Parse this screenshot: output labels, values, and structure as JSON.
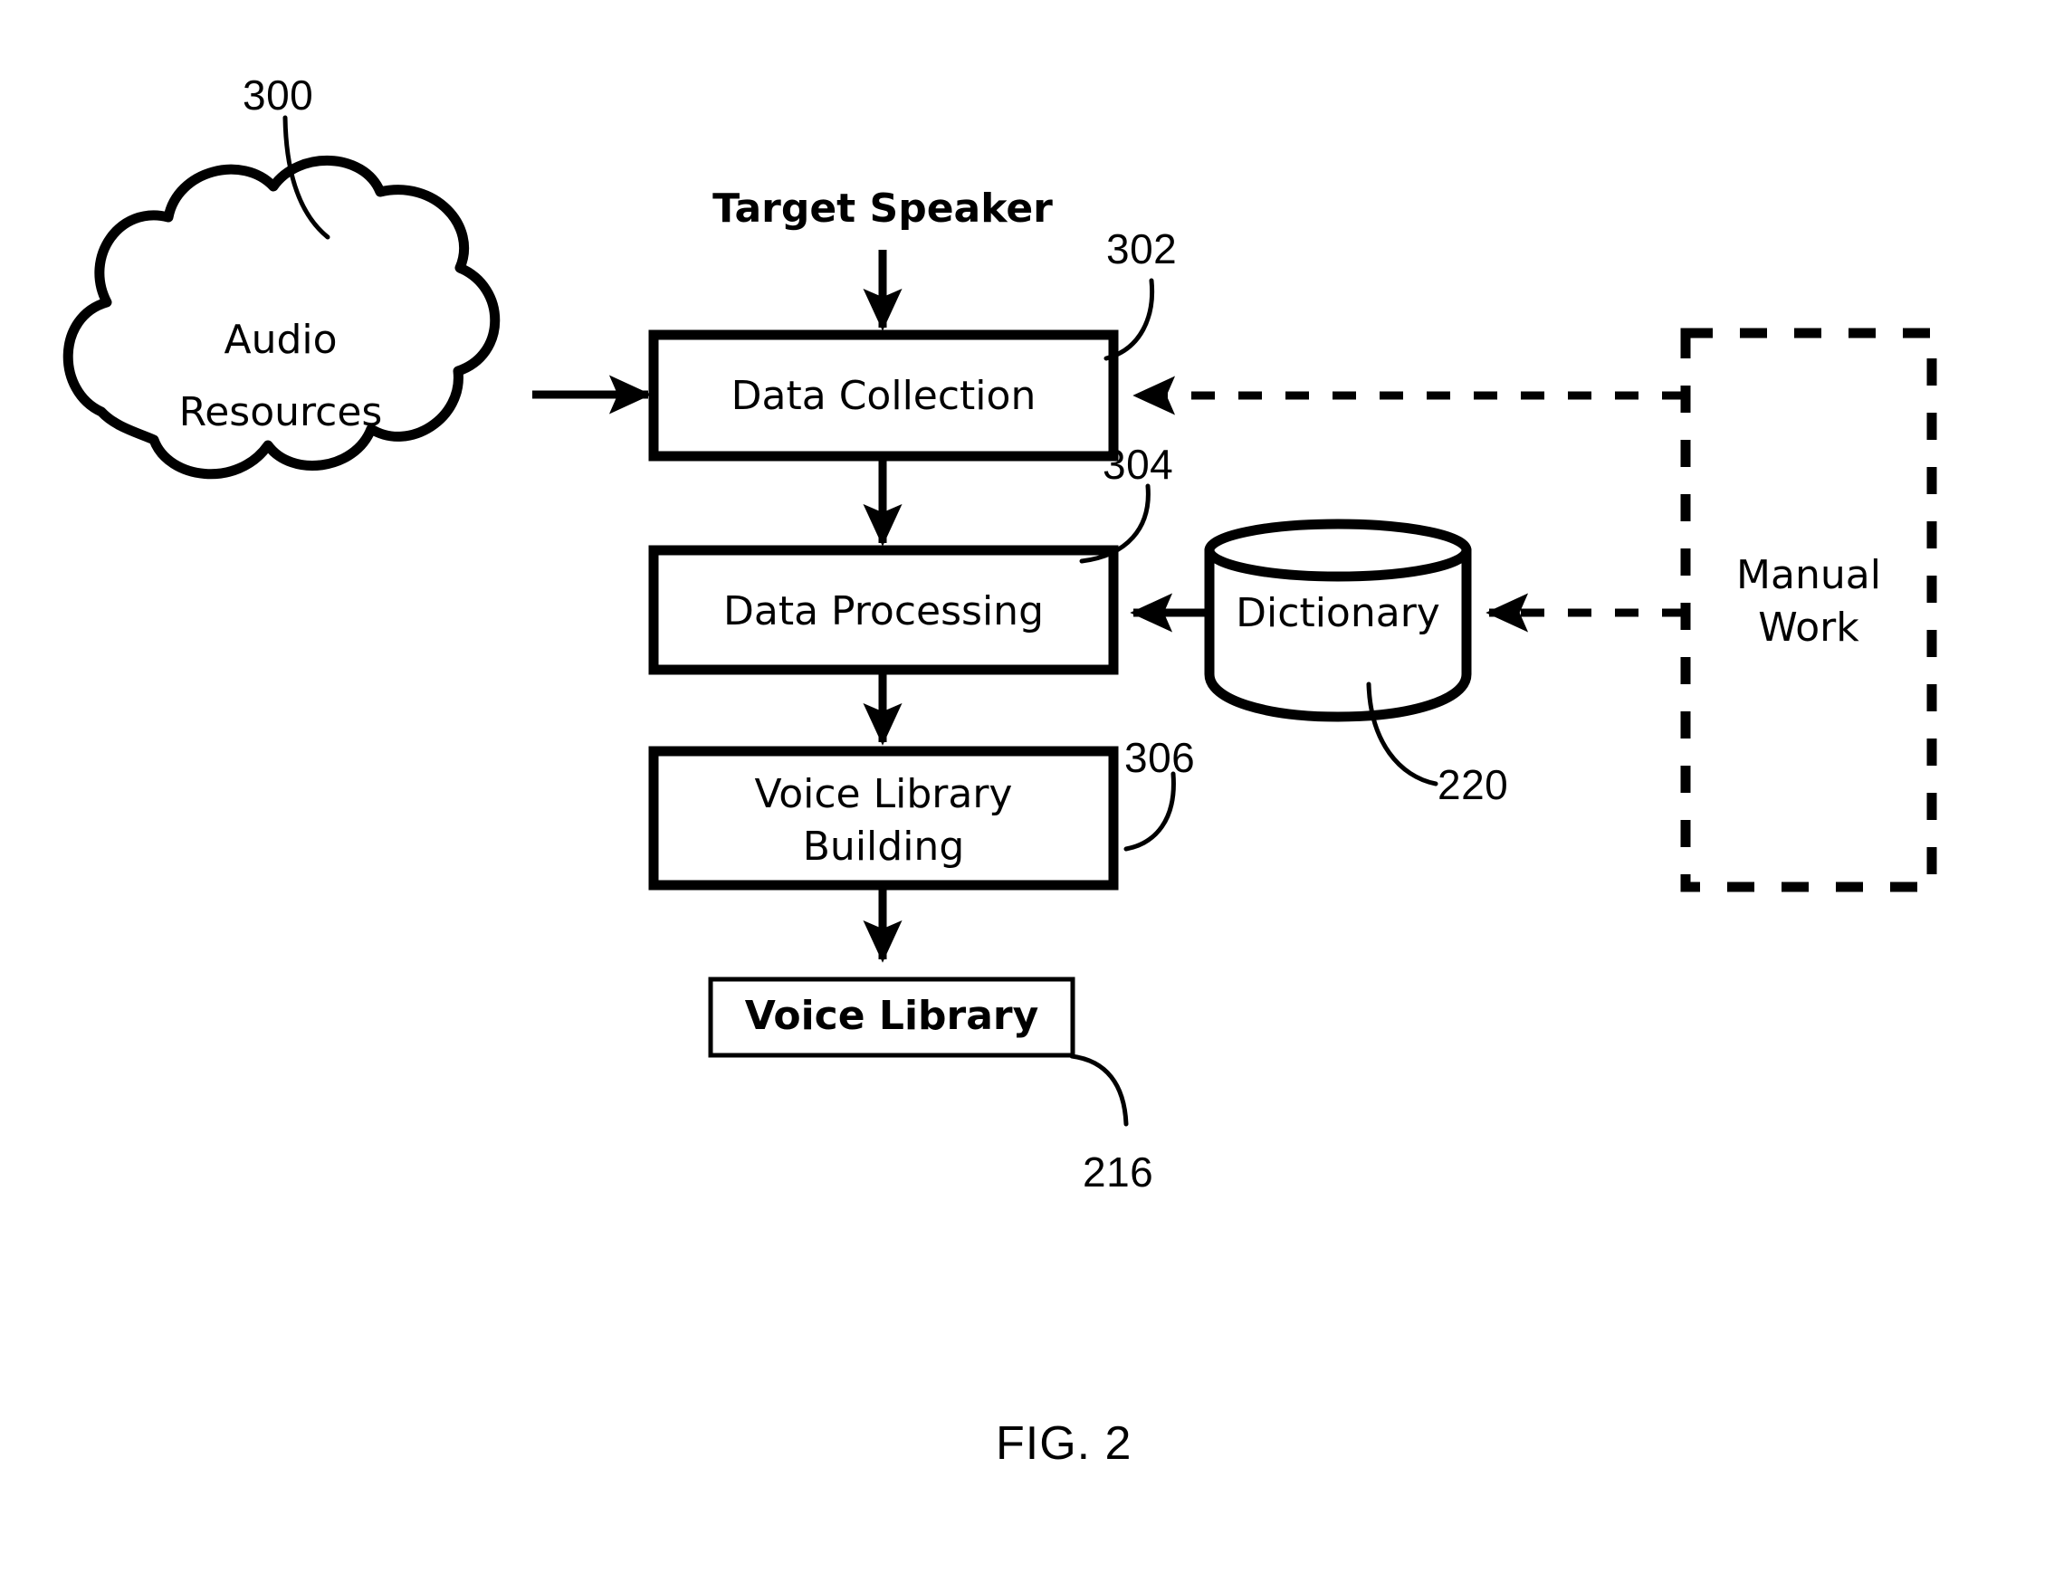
{
  "figure": {
    "caption": "FIG. 2",
    "reference_numerals": {
      "cloud": "300",
      "data_collection": "302",
      "data_processing": "304",
      "voice_library_building": "306",
      "dictionary": "220",
      "voice_library": "216"
    }
  },
  "nodes": {
    "audio_resources": {
      "line1": "Audio",
      "line2": "Resources",
      "shape": "cloud-shape"
    },
    "target_speaker": {
      "label": "Target Speaker",
      "shape": "text-annotation"
    },
    "data_collection": {
      "label": "Data Collection",
      "shape": "rectangle"
    },
    "data_processing": {
      "label": "Data Processing",
      "shape": "rectangle"
    },
    "voice_library_building": {
      "line1": "Voice Library",
      "line2": "Building",
      "shape": "rectangle"
    },
    "voice_library": {
      "label": "Voice Library",
      "shape": "thin-rectangle"
    },
    "dictionary": {
      "label": "Dictionary",
      "shape": "cylinder-database-shape"
    },
    "manual_work": {
      "line1": "Manual",
      "line2": "Work",
      "shape": "dashed-rectangle"
    }
  },
  "connectors": [
    {
      "name": "audio-resources-to-data-collection",
      "style": "solid-arrow"
    },
    {
      "name": "target-speaker-to-data-collection",
      "style": "solid-arrow"
    },
    {
      "name": "manual-work-to-data-collection",
      "style": "dashed-arrow"
    },
    {
      "name": "data-collection-to-data-processing",
      "style": "solid-arrow"
    },
    {
      "name": "dictionary-to-data-processing",
      "style": "solid-arrow"
    },
    {
      "name": "manual-work-to-dictionary",
      "style": "dashed-arrow"
    },
    {
      "name": "data-processing-to-voice-library-building",
      "style": "solid-arrow"
    },
    {
      "name": "voice-library-building-to-voice-library",
      "style": "solid-arrow"
    }
  ],
  "colors": {
    "ink": "#000000",
    "paper": "#ffffff"
  }
}
